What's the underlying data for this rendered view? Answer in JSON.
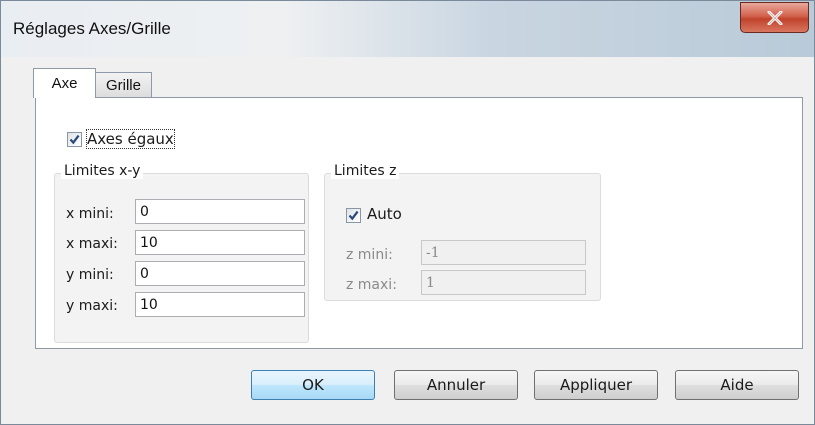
{
  "window": {
    "title": "Réglages Axes/Grille",
    "close_icon": "close-icon"
  },
  "tabs": [
    {
      "label": "Axe",
      "selected": true
    },
    {
      "label": "Grille",
      "selected": false
    }
  ],
  "axes_egaux": {
    "label": "Axes égaux",
    "checked": true
  },
  "limites_xy": {
    "title": "Limites x-y",
    "fields": [
      {
        "label": "x mini:",
        "value": "0"
      },
      {
        "label": "x maxi:",
        "value": "10"
      },
      {
        "label": "y mini:",
        "value": "0"
      },
      {
        "label": "y maxi:",
        "value": "10"
      }
    ]
  },
  "limites_z": {
    "title": "Limites z",
    "auto": {
      "label": "Auto",
      "checked": true
    },
    "fields": [
      {
        "label": "z mini:",
        "value": "-1",
        "disabled": true
      },
      {
        "label": "z maxi:",
        "value": "1",
        "disabled": true
      }
    ]
  },
  "buttons": {
    "ok": "OK",
    "annuler": "Annuler",
    "appliquer": "Appliquer",
    "aide": "Aide"
  },
  "colors": {
    "default_button": "#bee6fd",
    "close_button": "#c0432c",
    "check_mark": "#2b4a7a"
  }
}
